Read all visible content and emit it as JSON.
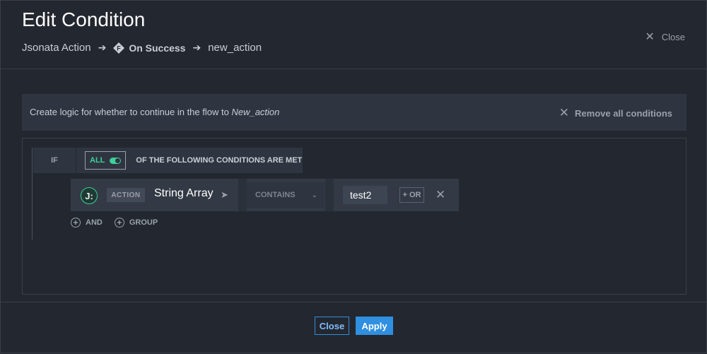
{
  "header": {
    "title": "Edit Condition",
    "close_label": "Close",
    "breadcrumb": {
      "source": "Jsonata Action",
      "trigger": "On Success",
      "target": "new_action"
    }
  },
  "banner": {
    "text_prefix": "Create logic for whether to continue in the flow to",
    "target_name": "New_action",
    "remove_all_label": "Remove all conditions"
  },
  "conditions": {
    "if_label": "IF",
    "match_mode": "ALL",
    "match_mode_enabled": true,
    "heading": "OF THE FOLLOWING CONDITIONS ARE MET",
    "rows": [
      {
        "source_badge": "ACTION",
        "field": "String Array",
        "operator": "CONTAINS",
        "value": "test2",
        "or_label": "+ OR"
      }
    ],
    "add_and_label": "AND",
    "add_group_label": "GROUP"
  },
  "footer": {
    "close_label": "Close",
    "apply_label": "Apply"
  },
  "colors": {
    "background": "#23272f",
    "accent_green": "#3ecf9a",
    "primary_blue": "#2f8fe0"
  }
}
